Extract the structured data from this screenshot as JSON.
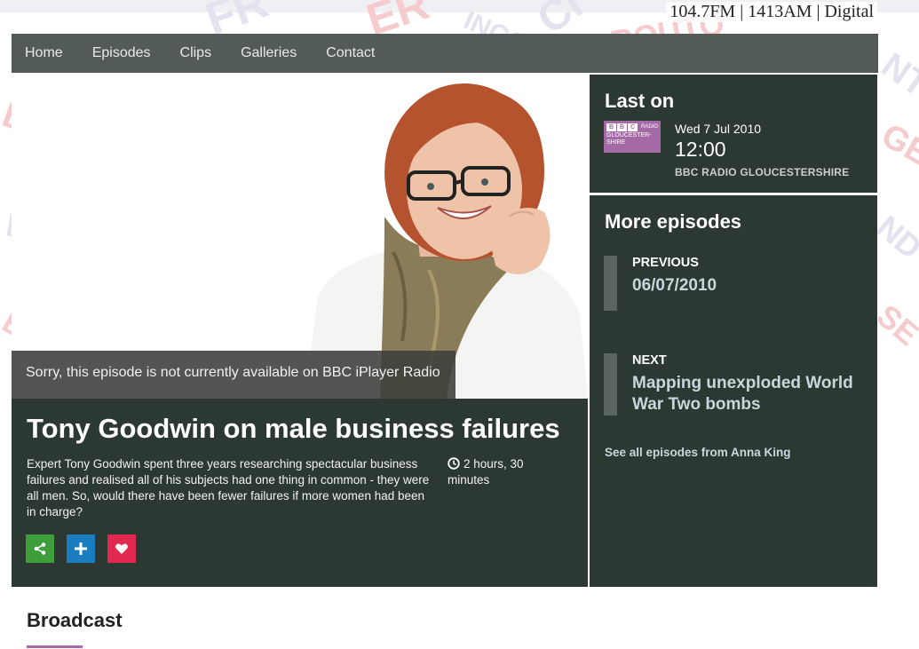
{
  "header": {
    "frequencies": "104.7FM | 1413AM | Digital"
  },
  "nav": {
    "items": [
      {
        "label": "Home"
      },
      {
        "label": "Episodes"
      },
      {
        "label": "Clips"
      },
      {
        "label": "Galleries"
      },
      {
        "label": "Contact"
      }
    ]
  },
  "hero": {
    "unavailable_message": "Sorry, this episode is not currently available on BBC iPlayer Radio"
  },
  "episode": {
    "title": "Tony Goodwin on male business failures",
    "description": "Expert Tony Goodwin spent three years researching spectacular business failures and realised all of his subjects had one thing in common - they were all men. So, would there have been fewer failures if more women had been in charge?",
    "duration": "2 hours, 30 minutes",
    "actions": [
      {
        "name": "share",
        "icon": "share-icon",
        "color": "#3f9e3c"
      },
      {
        "name": "add",
        "icon": "plus-icon",
        "color": "#1a7dc0"
      },
      {
        "name": "favourite",
        "icon": "heart-icon",
        "color": "#e2294f"
      }
    ]
  },
  "last_on": {
    "heading": "Last on",
    "logo": {
      "bbc": [
        "B",
        "B",
        "C"
      ],
      "radio": "RADIO",
      "name": "GLOUCESTER-SHIRE"
    },
    "date": "Wed 7 Jul 2010",
    "time": "12:00",
    "station": "BBC RADIO GLOUCESTERSHIRE"
  },
  "more_episodes": {
    "heading": "More episodes",
    "previous": {
      "label": "PREVIOUS",
      "value": "06/07/2010"
    },
    "next": {
      "label": "NEXT",
      "value": "Mapping unexploded World War Two bombs"
    },
    "see_all": "See all episodes from Anna King"
  },
  "broadcast": {
    "heading": "Broadcast"
  },
  "colors": {
    "panel": "#2c3832",
    "nav": "#525b55",
    "accent": "#a46aa5",
    "link": "#c9d6dc"
  }
}
